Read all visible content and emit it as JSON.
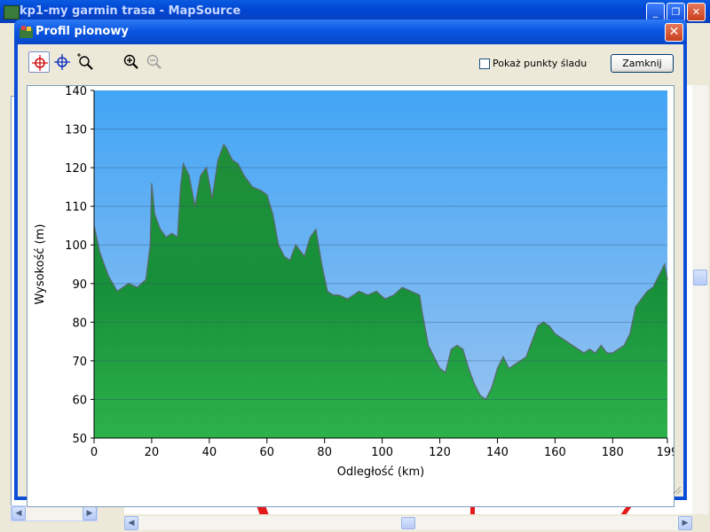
{
  "background_window": {
    "title": "kp1-my garmin trasa - MapSource"
  },
  "dialog": {
    "title": "Profil pionowy",
    "close_label": "✕",
    "toolbar": {
      "icons": [
        "select-crosshair-icon",
        "move-crosshair-icon",
        "zoom-area-icon",
        "zoom-in-icon",
        "zoom-out-icon"
      ]
    },
    "show_track_points_label": "Pokaż punkty śladu",
    "show_track_points_checked": false,
    "close_button_label": "Zamknij"
  },
  "colors": {
    "sky": "#42a5f5",
    "terrain": "#2db24a",
    "titlebar": "#0a56e2"
  },
  "chart_data": {
    "type": "area",
    "title": "",
    "xlabel": "Odległość   (km)",
    "ylabel": "Wysokość (m)",
    "xlim": [
      0,
      199
    ],
    "ylim": [
      50,
      140
    ],
    "x_ticks": [
      "0",
      "20",
      "40",
      "60",
      "80",
      "100",
      "120",
      "140",
      "160",
      "180",
      "199"
    ],
    "y_ticks": [
      "140",
      "130",
      "120",
      "110",
      "100",
      "90",
      "80",
      "70",
      "60",
      "50"
    ],
    "grid": true,
    "x": [
      0,
      2,
      5,
      8,
      12,
      15,
      18,
      19.5,
      20,
      21,
      23,
      25,
      27,
      29,
      30,
      31,
      33,
      35,
      37,
      39,
      41,
      43,
      45,
      46,
      48,
      50,
      52,
      55,
      58,
      60,
      62,
      64,
      66,
      68,
      70,
      73,
      75,
      77,
      79,
      81,
      83,
      85,
      88,
      92,
      95,
      98,
      101,
      104,
      107,
      110,
      113,
      114,
      116,
      118,
      120,
      122,
      124,
      126,
      128,
      130,
      132,
      134,
      136,
      138,
      140,
      142,
      144,
      146,
      148,
      150,
      152,
      154,
      156,
      158,
      160,
      162,
      164,
      166,
      168,
      170,
      172,
      174,
      176,
      178,
      180,
      182,
      184,
      186,
      188,
      190,
      192,
      194,
      196,
      198,
      199
    ],
    "y": [
      105,
      98,
      92,
      88,
      90,
      89,
      91,
      100,
      116,
      108,
      104,
      102,
      103,
      102,
      115,
      121,
      118,
      110,
      118,
      120,
      112,
      122,
      126,
      125,
      122,
      121,
      118,
      115,
      114,
      113,
      108,
      100,
      97,
      96,
      100,
      97,
      102,
      104,
      95,
      88,
      87,
      87,
      86,
      88,
      87,
      88,
      86,
      87,
      89,
      88,
      87,
      82,
      74,
      71,
      68,
      67,
      73,
      74,
      73,
      68,
      64,
      61,
      60,
      63,
      68,
      71,
      68,
      69,
      70,
      71,
      75,
      79,
      80,
      79,
      77,
      76,
      75,
      74,
      73,
      72,
      73,
      72,
      74,
      72,
      72,
      73,
      74,
      77,
      84,
      86,
      88,
      89,
      92,
      95,
      91
    ]
  }
}
